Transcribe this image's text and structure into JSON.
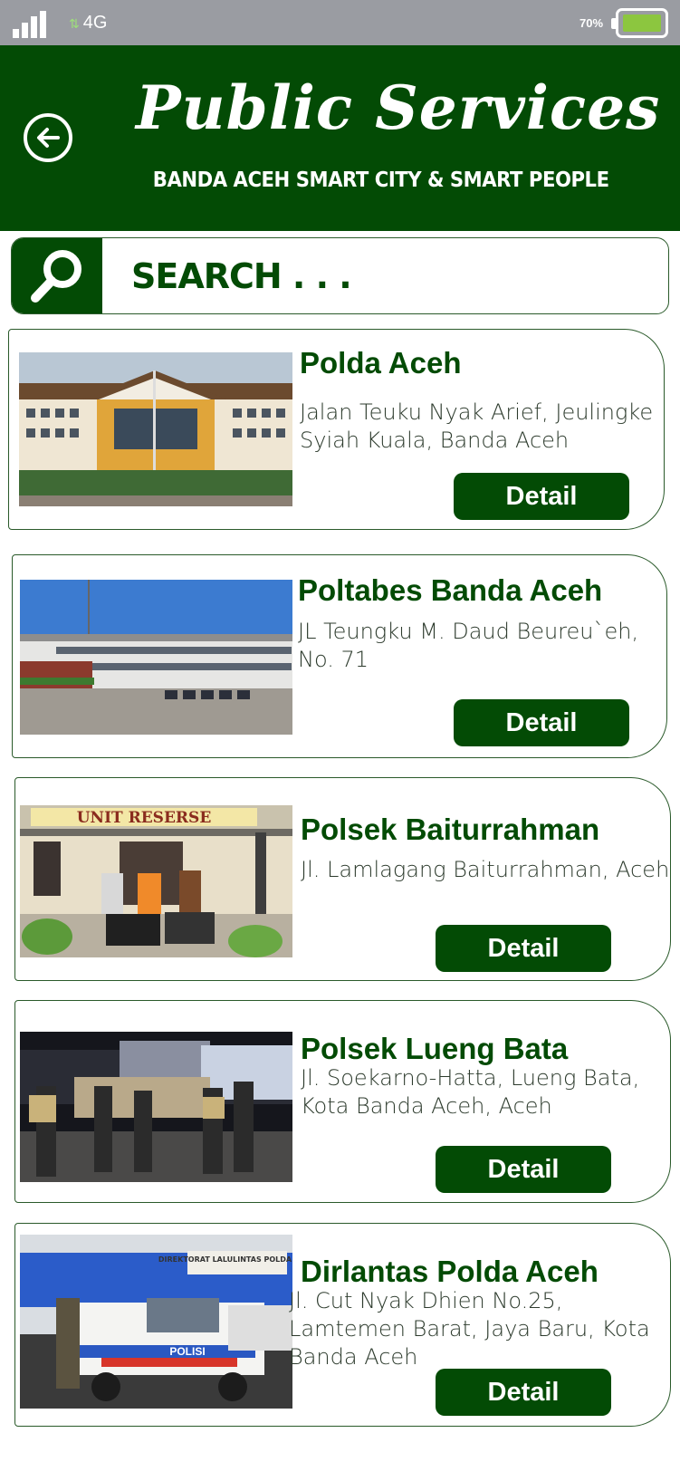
{
  "status_bar": {
    "network": "4G",
    "battery_percent": "70%"
  },
  "header": {
    "title": "Public Services",
    "subtitle": "BANDA ACEH SMART CITY & SMART PEOPLE"
  },
  "search": {
    "placeholder": "SEARCH . . ."
  },
  "colors": {
    "brand_green": "#034b05",
    "status_bar": "#9a9ca2",
    "battery_fill": "#8cc63f"
  },
  "services": [
    {
      "name": "Polda Aceh",
      "address": "Jalan Teuku Nyak Arief, Jeulingke Syiah Kuala, Banda Aceh",
      "button": "Detail"
    },
    {
      "name": "Poltabes Banda Aceh",
      "address": "JL Teungku M. Daud Beureu`eh, No. 71",
      "button": "Detail"
    },
    {
      "name": "Polsek Baiturrahman",
      "address": "Jl. Lamlagang Baiturrahman, Aceh",
      "button": "Detail"
    },
    {
      "name": "Polsek Lueng Bata",
      "address": "Jl. Soekarno-Hatta, Lueng Bata, Kota Banda Aceh, Aceh",
      "button": "Detail"
    },
    {
      "name": "Dirlantas Polda Aceh",
      "address": "Jl. Cut Nyak Dhien No.25, Lamtemen Barat, Jaya Baru, Kota Banda Aceh",
      "button": "Detail"
    }
  ],
  "photo_captions": {
    "unit_reserse": "UNIT RESERSE",
    "direktorat": "DIREKTORAT LALULINTAS POLDA ACEH",
    "polisi": "POLISI"
  }
}
